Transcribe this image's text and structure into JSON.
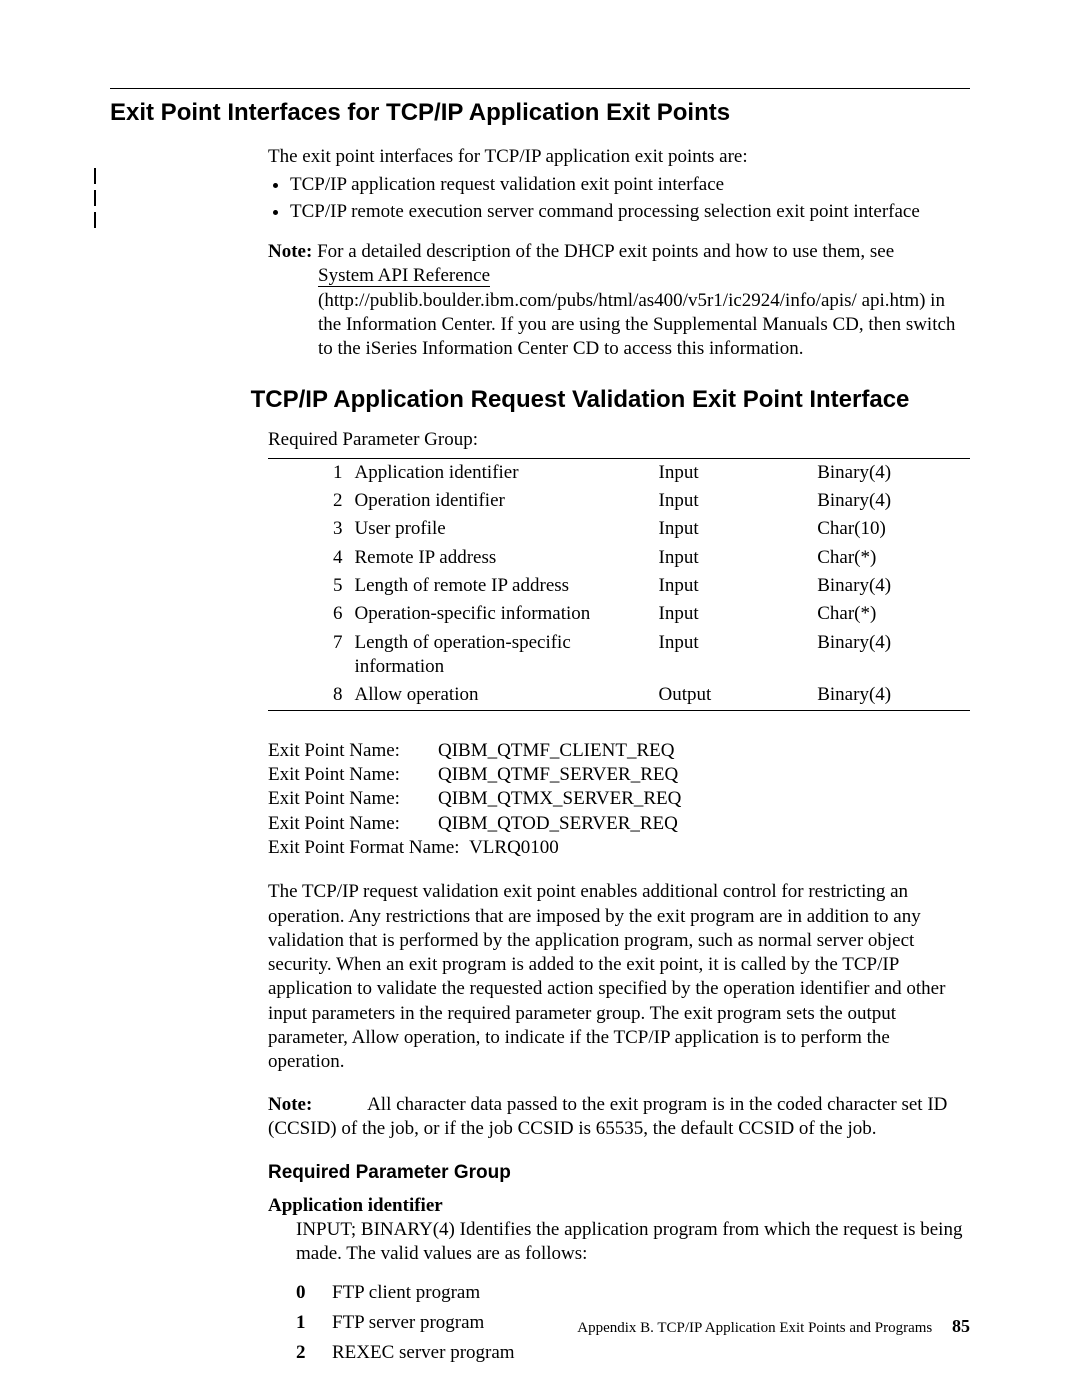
{
  "headings": {
    "h1": "Exit Point Interfaces for TCP/IP Application Exit Points",
    "h2": "TCP/IP Application Request Validation Exit Point Interface",
    "h3": "Required Parameter Group"
  },
  "intro": {
    "lead": "The exit point interfaces for TCP/IP application exit points are:",
    "bullets": [
      "TCP/IP application request validation exit point interface",
      "TCP/IP remote execution server command processing selection exit point interface"
    ]
  },
  "note1": {
    "label": "Note:",
    "body1": "For a detailed description of the DHCP exit points and how to use them, see",
    "link": "System API Reference",
    "body2": "(http://publib.boulder.ibm.com/pubs/html/as400/v5r1/ic2924/info/apis/ api.htm) in the Information Center. If you are using the Supplemental Manuals CD, then switch to the iSeries Information Center CD to access this information."
  },
  "param_group_label": "Required Parameter Group:",
  "params": [
    {
      "n": "1",
      "name": "Application identifier",
      "io": "Input",
      "type": "Binary(4)"
    },
    {
      "n": "2",
      "name": "Operation identifier",
      "io": "Input",
      "type": "Binary(4)"
    },
    {
      "n": "3",
      "name": "User profile",
      "io": "Input",
      "type": "Char(10)"
    },
    {
      "n": "4",
      "name": "Remote IP address",
      "io": "Input",
      "type": "Char(*)"
    },
    {
      "n": "5",
      "name": "Length of remote IP address",
      "io": "Input",
      "type": "Binary(4)"
    },
    {
      "n": "6",
      "name": "Operation-specific information",
      "io": "Input",
      "type": "Char(*)"
    },
    {
      "n": "7",
      "name": "Length of operation-specific information",
      "io": "Input",
      "type": "Binary(4)"
    },
    {
      "n": "8",
      "name": "Allow operation",
      "io": "Output",
      "type": "Binary(4)"
    }
  ],
  "exit_names": {
    "label": "Exit Point Name:",
    "values": [
      "QIBM_QTMF_CLIENT_REQ",
      "QIBM_QTMF_SERVER_REQ",
      "QIBM_QTMX_SERVER_REQ",
      "QIBM_QTOD_SERVER_REQ"
    ],
    "format_label": "Exit Point Format Name:",
    "format_value": "VLRQ0100"
  },
  "long_para": "The TCP/IP request validation exit point enables additional control for restricting an operation. Any restrictions that are imposed by the exit program are in addition to any validation that is performed by the application program, such as normal server object security. When an exit program is added to the exit point, it is called by the TCP/IP application to validate the requested action specified by the operation identifier and other input parameters in the required parameter group. The exit program sets the output parameter, Allow operation, to indicate if the TCP/IP application is to perform the operation.",
  "note2": {
    "label": "Note:",
    "body": "All character data passed to the exit program is in the coded character set ID (CCSID) of the job, or if the job CCSID is 65535, the default CCSID of the job."
  },
  "param_def": {
    "name": "Application identifier",
    "desc": "INPUT; BINARY(4) Identifies the application program from which the request is being made. The valid values are as follows:",
    "values": [
      {
        "n": "0",
        "text": "FTP client program"
      },
      {
        "n": "1",
        "text": "FTP server program"
      },
      {
        "n": "2",
        "text": "REXEC server program"
      }
    ]
  },
  "footer": {
    "text": "Appendix B. TCP/IP Application Exit Points and Programs",
    "page": "85"
  }
}
